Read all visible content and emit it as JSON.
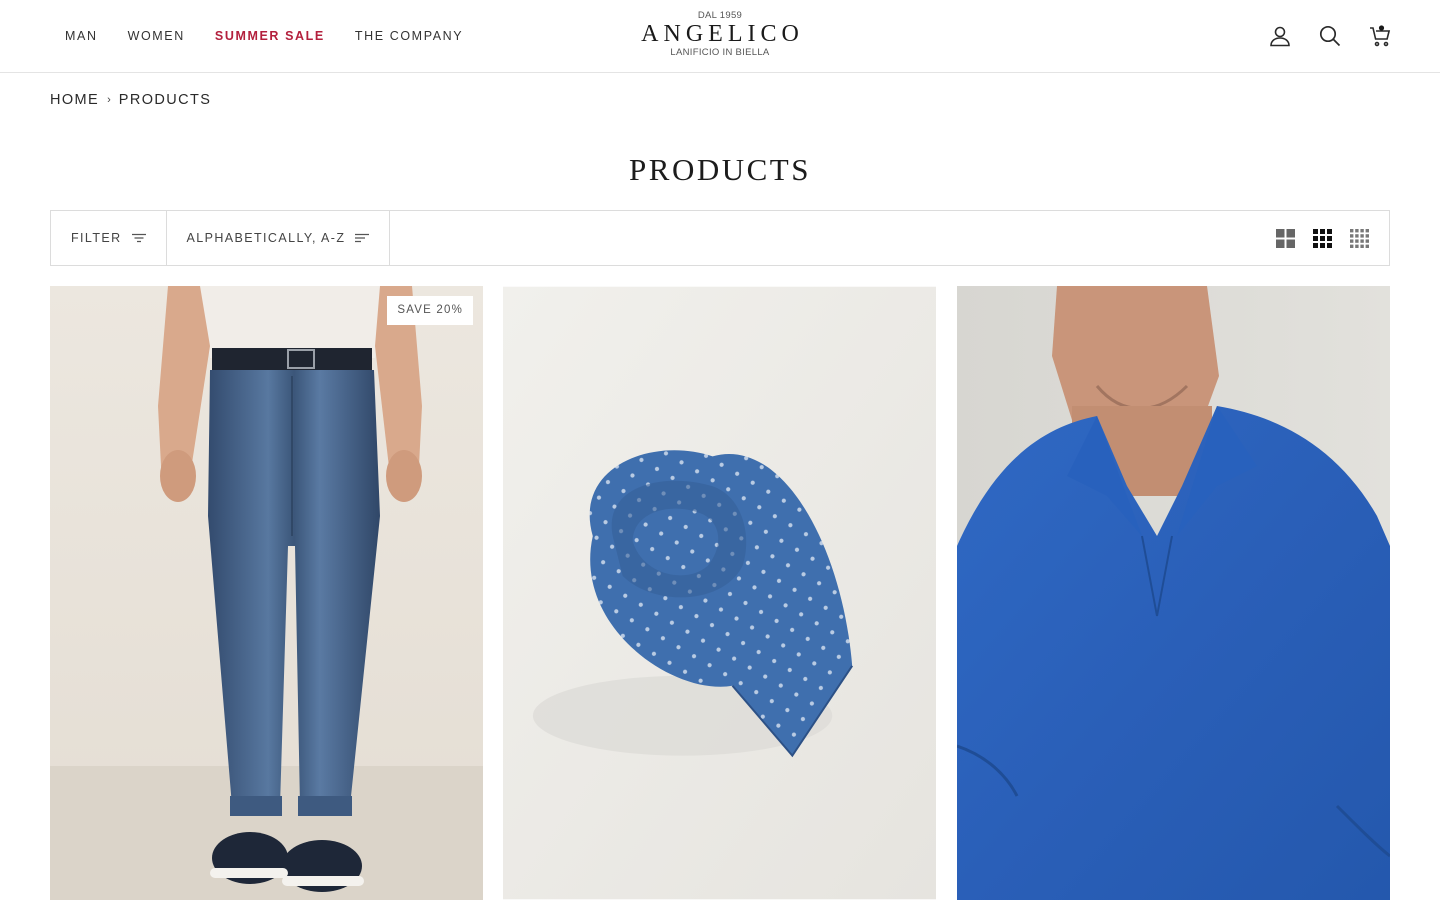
{
  "nav": {
    "items": [
      {
        "label": "MAN"
      },
      {
        "label": "WOMEN"
      },
      {
        "label": "SUMMER SALE"
      },
      {
        "label": "THE COMPANY"
      }
    ]
  },
  "logo": {
    "since": "DAL 1959",
    "brand": "ANGELICO",
    "tagline": "LANIFICIO IN BIELLA"
  },
  "header_icons": [
    "account-icon",
    "search-icon",
    "cart-icon"
  ],
  "breadcrumb": {
    "home": "HOME",
    "separator": "›",
    "current": "PRODUCTS"
  },
  "page": {
    "title": "PRODUCTS"
  },
  "toolbar": {
    "filter_label": "FILTER",
    "sort_label": "ALPHABETICALLY, A-Z",
    "layout_options": [
      "grid-2-icon",
      "grid-3-icon",
      "grid-4-icon"
    ]
  },
  "products": [
    {
      "badge": "SAVE 20%",
      "image": "man-wearing-blue-jeans"
    },
    {
      "image": "rolled-blue-patterned-tie"
    },
    {
      "image": "man-wearing-blue-polo-shirt"
    }
  ],
  "colors": {
    "sale_accent": "#b3203d",
    "text": "#222222",
    "border": "#dcdcdc"
  }
}
